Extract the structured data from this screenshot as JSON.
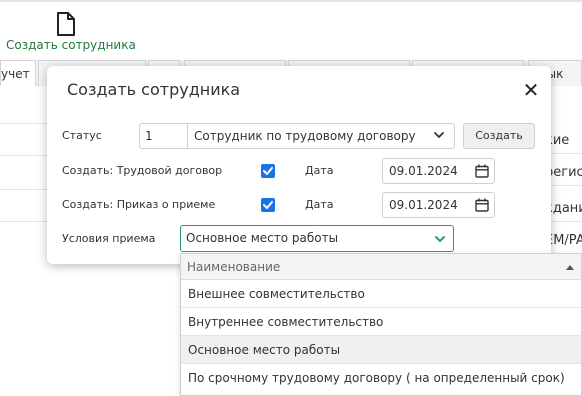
{
  "toolbar": {
    "create_employee_label": "Создать сотрудника",
    "icon": "document-icon"
  },
  "background_tabs": [
    "учет",
    "",
    "",
    "",
    "",
    "",
    "язык"
  ],
  "background_grid": {
    "left_cells": [
      "",
      "",
      "",
      ""
    ],
    "right_cells": [
      "кие",
      "регис",
      "кдани",
      "EM/PA"
    ]
  },
  "modal": {
    "title": "Создать сотрудника",
    "close_glyph": "✕",
    "status": {
      "label": "Статус",
      "number": "1",
      "value": "Сотрудник по трудовому договору"
    },
    "create_button": "Создать",
    "labor_contract": {
      "label": "Создать: Трудовой договор",
      "checked": true,
      "date_label": "Дата",
      "date": "09.01.2024"
    },
    "hiring_order": {
      "label": "Создать: Приказ о приеме",
      "checked": true,
      "date_label": "Дата",
      "date": "09.01.2024"
    },
    "conditions": {
      "label": "Условия приема",
      "value": "Основное место работы"
    }
  },
  "dropdown": {
    "header": "Наименование",
    "options": [
      "Внешнее совместительство",
      "Внутреннее совместительство",
      "Основное место работы",
      "По срочному трудовому договору ( на определенный срок)"
    ],
    "selected_index": 2
  },
  "colors": {
    "accent_green": "#2e9e66",
    "checkbox_blue": "#1a73e8",
    "toolbar_text_green": "#1f7a3a"
  }
}
